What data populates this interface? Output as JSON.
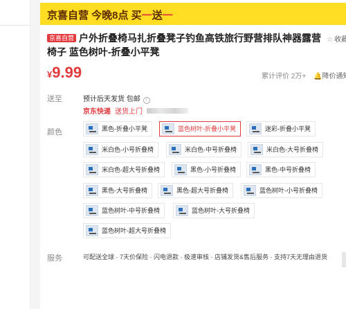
{
  "banner": {
    "prefix": "京喜自营  今晚8点 买",
    "red1": "一",
    "mid": "送",
    "red2": "一"
  },
  "title": {
    "badge": "京喜自营",
    "text": "户外折叠椅马扎折叠凳子钓鱼高铁旅行野营排队神器露营椅子 蓝色树叶-折叠小平凳"
  },
  "collect_label": "收藏",
  "price": {
    "symbol": "¥",
    "value": "9.99"
  },
  "reviews": "累计评价 2万+",
  "notify": "降价通知",
  "shipping": {
    "label": "送至",
    "line1": "预计后天发货  包邮",
    "jd_express": "京东快递",
    "door": "送货上门"
  },
  "color": {
    "label": "颜色",
    "options": [
      "黑色-折叠小平凳",
      "蓝色树叶-折叠小平凳",
      "迷彩-折叠小平凳",
      "米白色-小号折叠椅",
      "米白色-中号折叠椅",
      "米白色-大号折叠椅",
      "米白色-超大号折叠椅",
      "黑色-小号折叠椅",
      "黑色-中号折叠椅",
      "黑色-大号折叠椅",
      "黑色-超大号折叠椅",
      "蓝色树叶-小号折叠椅",
      "蓝色树叶-中号折叠椅",
      "蓝色树叶-大号折叠椅",
      "蓝色树叶-超大号折叠椅"
    ],
    "selected": "蓝色树叶-折叠小平凳"
  },
  "service": {
    "label": "服务",
    "text": "可配送全球 · 7天价保险 · 闪电退款 · 极速审核 · 店铺发货&售后服务 · 支持7天无理由退货"
  },
  "colors": {
    "accent": "#e4393c",
    "banner": "#ffdd22"
  }
}
